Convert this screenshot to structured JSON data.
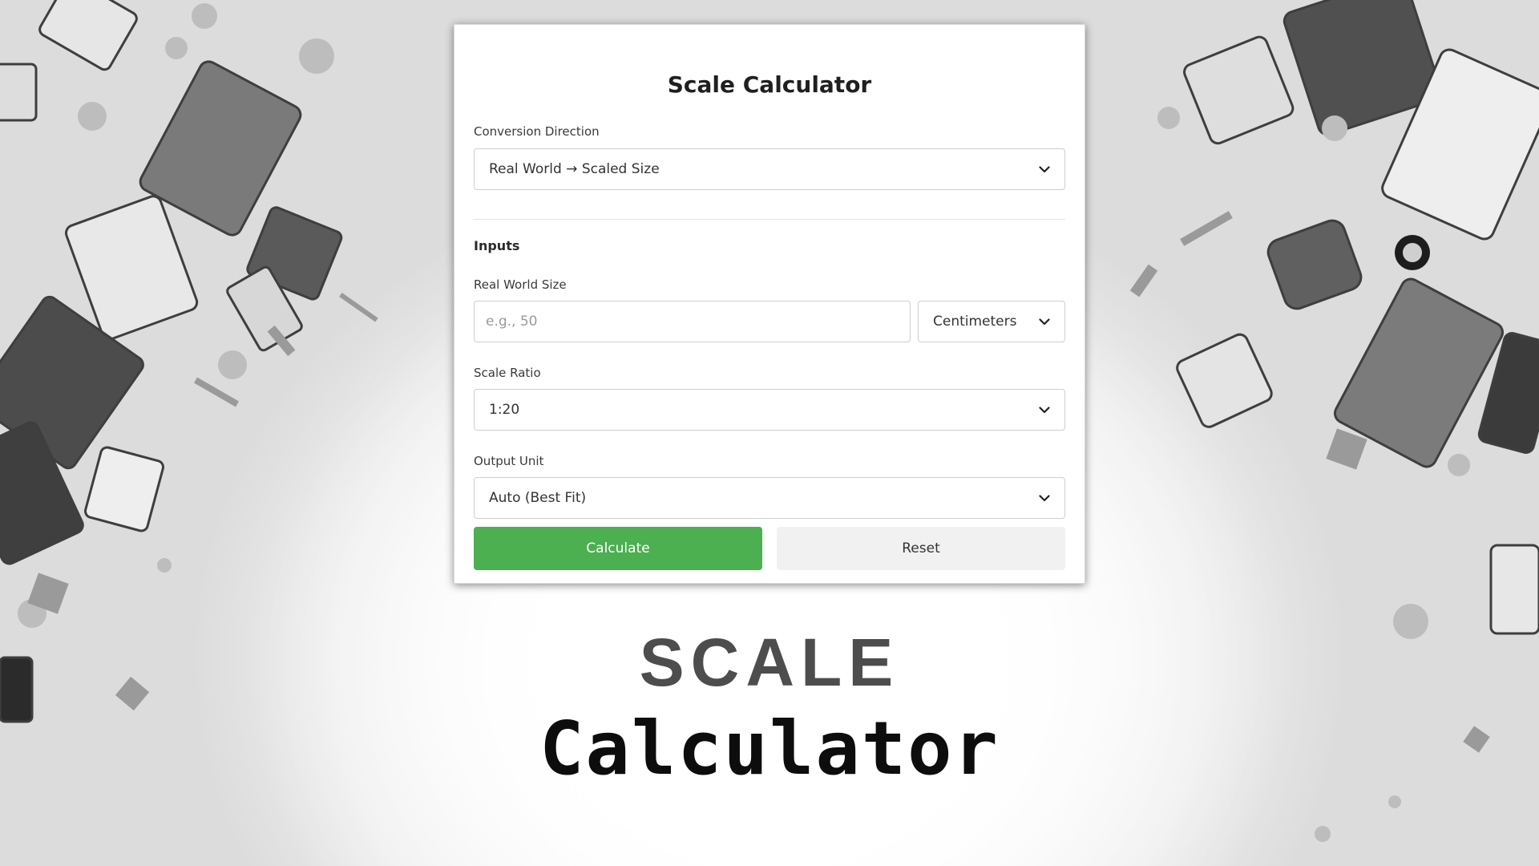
{
  "card": {
    "title": "Scale Calculator",
    "conversion_direction": {
      "label": "Conversion Direction",
      "value": "Real World → Scaled Size"
    },
    "inputs_heading": "Inputs",
    "real_world_size": {
      "label": "Real World Size",
      "placeholder": "e.g., 50",
      "value": "",
      "unit": "Centimeters"
    },
    "scale_ratio": {
      "label": "Scale Ratio",
      "value": "1:20"
    },
    "output_unit": {
      "label": "Output Unit",
      "value": "Auto (Best Fit)"
    },
    "buttons": {
      "calculate": "Calculate",
      "reset": "Reset"
    }
  },
  "hero": {
    "line1": "SCALE",
    "line2": "Calculator"
  },
  "colors": {
    "accent": "#4caf50",
    "reset_bg": "#f1f1f1"
  },
  "icons": {
    "dropdown": "chevron-down-icon"
  }
}
